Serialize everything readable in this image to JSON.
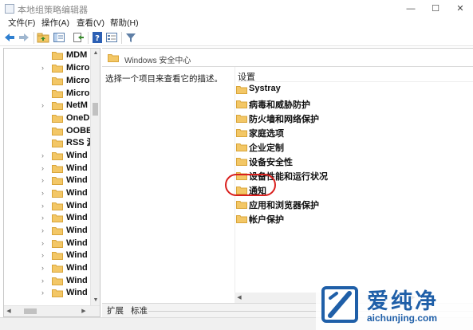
{
  "window": {
    "title": "本地组策略编辑器",
    "controls": {
      "minimize": "—",
      "maximize": "☐",
      "close": "✕"
    }
  },
  "menu": [
    "文件(F)",
    "操作(A)",
    "查看(V)",
    "帮助(H)"
  ],
  "toolbar": {
    "icons": [
      "back-icon",
      "forward-icon",
      "up-folder-icon",
      "show-hide-tree-icon",
      "export-list-icon",
      "help-icon",
      "properties-icon",
      "filter-icon"
    ]
  },
  "tree": {
    "items": [
      {
        "label": "MDM",
        "has_children": false
      },
      {
        "label": "Micro",
        "has_children": true
      },
      {
        "label": "Micro",
        "has_children": false
      },
      {
        "label": "Micro",
        "has_children": false
      },
      {
        "label": "NetM",
        "has_children": true
      },
      {
        "label": "OneD",
        "has_children": false
      },
      {
        "label": "OOBE",
        "has_children": false
      },
      {
        "label": "RSS 源",
        "has_children": false
      },
      {
        "label": "Wind",
        "has_children": true
      },
      {
        "label": "Wind",
        "has_children": true
      },
      {
        "label": "Wind",
        "has_children": true
      },
      {
        "label": "Wind",
        "has_children": true
      },
      {
        "label": "Wind",
        "has_children": true
      },
      {
        "label": "Wind",
        "has_children": true
      },
      {
        "label": "Wind",
        "has_children": true
      },
      {
        "label": "Wind",
        "has_children": true
      },
      {
        "label": "Wind",
        "has_children": true
      },
      {
        "label": "Wind",
        "has_children": true
      },
      {
        "label": "Wind",
        "has_children": true
      },
      {
        "label": "Wind",
        "has_children": true
      }
    ]
  },
  "right_pane": {
    "path": "Windows 安全中心",
    "description": "选择一个项目来查看它的描述。",
    "column_header": "设置",
    "items": [
      "Systray",
      "病毒和威胁防护",
      "防火墙和网络保护",
      "家庭选项",
      "企业定制",
      "设备安全性",
      "设备性能和运行状况",
      "通知",
      "应用和浏览器保护",
      "帐户保护"
    ],
    "highlighted_item": "通知"
  },
  "tabs": [
    "扩展",
    "标准"
  ],
  "watermark": {
    "brand": "爱纯净",
    "url": "aichunjing.com"
  },
  "colors": {
    "folder": "#f3c766",
    "folder_edge": "#d9a53a",
    "highlight": "#d9201e",
    "brand": "#1f5fa8"
  }
}
